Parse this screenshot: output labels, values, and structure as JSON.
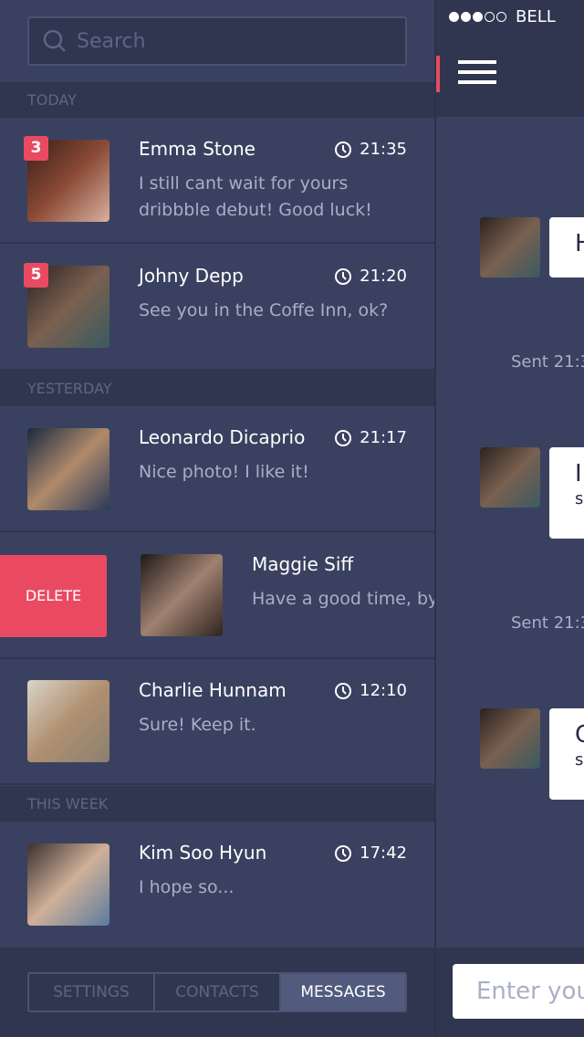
{
  "search": {
    "placeholder": "Search"
  },
  "sections": [
    "TODAY",
    "YESTERDAY",
    "THIS WEEK"
  ],
  "conversations": [
    {
      "name": "Emma Stone",
      "time": "21:35",
      "badge": "3",
      "message_line1": "I still cant wait for yours",
      "message_line2": "dribbble debut! Good luck!",
      "avatar_color": "#8a4a36"
    },
    {
      "name": "Johny Depp",
      "time": "21:20",
      "badge": "5",
      "message_line1": "See you in the Coffe Inn, ok?",
      "avatar_color": "#5a4a3e"
    },
    {
      "name": "Leonardo Dicaprio",
      "time": "21:17",
      "message_line1": "Nice photo! I like it!",
      "avatar_color": "#8a6a52"
    },
    {
      "name": "Maggie Siff",
      "message_line1": "Have a good time, by",
      "delete_label": "DELETE",
      "avatar_color": "#4e3a34"
    },
    {
      "name": "Charlie Hunnam",
      "time": "12:10",
      "message_line1": "Sure! Keep it.",
      "avatar_color": "#a8a092"
    },
    {
      "name": "Kim Soo Hyun",
      "time": "17:42",
      "message_line1": "I hope so...",
      "avatar_color": "#6a7a8e"
    }
  ],
  "tabs": [
    {
      "label": "SETTINGS",
      "active": false
    },
    {
      "label": "CONTACTS",
      "active": false
    },
    {
      "label": "MESSAGES",
      "active": true
    }
  ],
  "chat": {
    "status_carrier": "BELL",
    "signal_bars": 3,
    "messages": [
      {
        "line1": "H"
      },
      {
        "line1": "I",
        "line2": "s"
      },
      {
        "line1": "C",
        "line2": "s"
      }
    ],
    "sent": [
      "Sent 21:3",
      "Sent 21:3"
    ],
    "input_placeholder": "Enter you"
  },
  "colors": {
    "accent": "#e94a62",
    "background": "#3a4160",
    "band": "#30364f"
  }
}
